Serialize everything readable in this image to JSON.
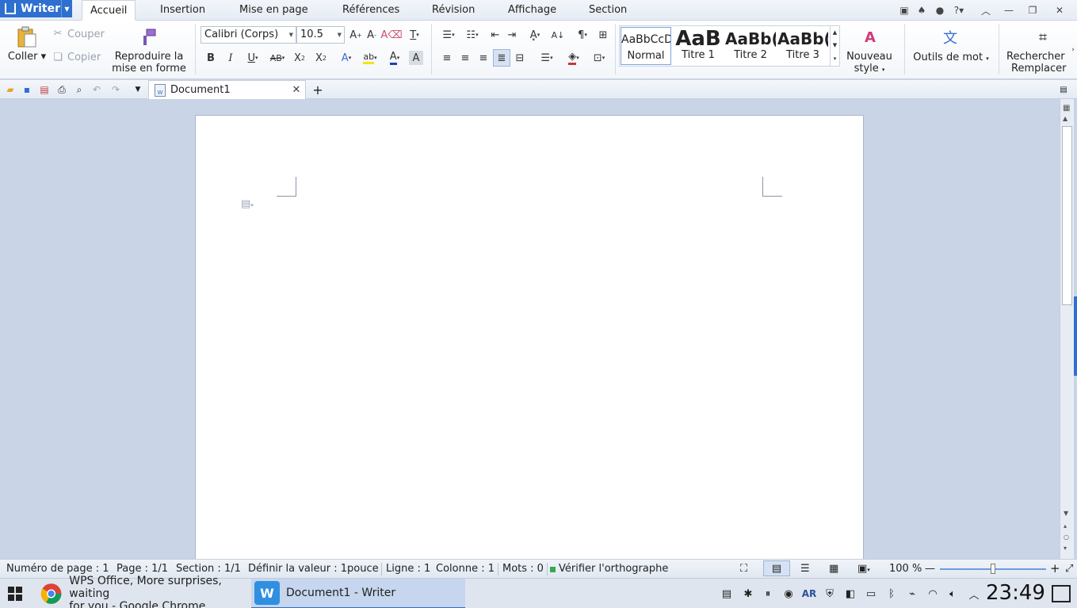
{
  "app": {
    "name": "Writer"
  },
  "menu": {
    "tabs": [
      "Accueil",
      "Insertion",
      "Mise en page",
      "Références",
      "Révision",
      "Affichage",
      "Section"
    ],
    "active": "Accueil"
  },
  "ribbon": {
    "clipboard": {
      "paste": "Coller",
      "cut": "Couper",
      "copy": "Copier",
      "format_painter_line1": "Reproduire la",
      "format_painter_line2": "mise en forme"
    },
    "font": {
      "name": "Calibri (Corps)",
      "size": "10.5"
    },
    "styles": [
      {
        "sample": "AaBbCcD",
        "name": "Normal"
      },
      {
        "sample": "AaB",
        "name": "Titre 1"
      },
      {
        "sample": "AaBb(",
        "name": "Titre 2"
      },
      {
        "sample": "AaBb(",
        "name": "Titre 3"
      }
    ],
    "new_style_line1": "Nouveau",
    "new_style_line2": "style",
    "word_tools": "Outils de mot",
    "find_line1": "Rechercher",
    "find_line2": "Remplacer"
  },
  "document_tab": {
    "title": "Document1"
  },
  "statusbar": {
    "page_number": "Numéro de page : 1",
    "page": "Page : 1/1",
    "section": "Section : 1/1",
    "set_value": "Définir la valeur : 1pouce",
    "line": "Ligne : 1",
    "column": "Colonne : 1",
    "words": "Mots : 0",
    "spellcheck": "Vérifier l'orthographe",
    "zoom": "100 %",
    "zoom_fraction": 0.5
  },
  "taskbar": {
    "chrome_line1": "WPS Office, More surprises, waiting",
    "chrome_line2": "for you - Google Chrome",
    "writer_task": "Document1 - Writer",
    "lang": "AR",
    "clock": "23:49"
  },
  "colors": {
    "accent": "#2f6fcf",
    "active_task": "#c6d6ee"
  }
}
